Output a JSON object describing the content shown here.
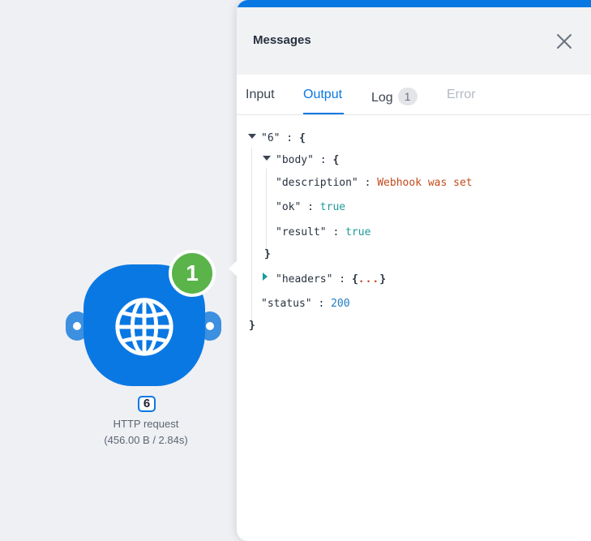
{
  "node": {
    "id": "6",
    "badge_count": "1",
    "title": "HTTP request",
    "subtitle": "(456.00 B / 2.84s)",
    "icon": "globe-icon",
    "color": "#0a78e3",
    "badge_color": "#5ab44a"
  },
  "panel": {
    "title": "Messages",
    "close_icon": "close-icon",
    "tabs": {
      "input": "Input",
      "output": "Output",
      "log": "Log",
      "log_count": "1",
      "error": "Error"
    },
    "active_tab": "Output"
  },
  "json_tree": {
    "root_key": "\"6\"",
    "body_key": "\"body\"",
    "description_key": "\"description\"",
    "description_value": "Webhook was set",
    "ok_key": "\"ok\"",
    "ok_value": "true",
    "result_key": "\"result\"",
    "result_value": "true",
    "headers_key": "\"headers\"",
    "headers_collapsed": "...",
    "status_key": "\"status\"",
    "status_value": "200"
  }
}
